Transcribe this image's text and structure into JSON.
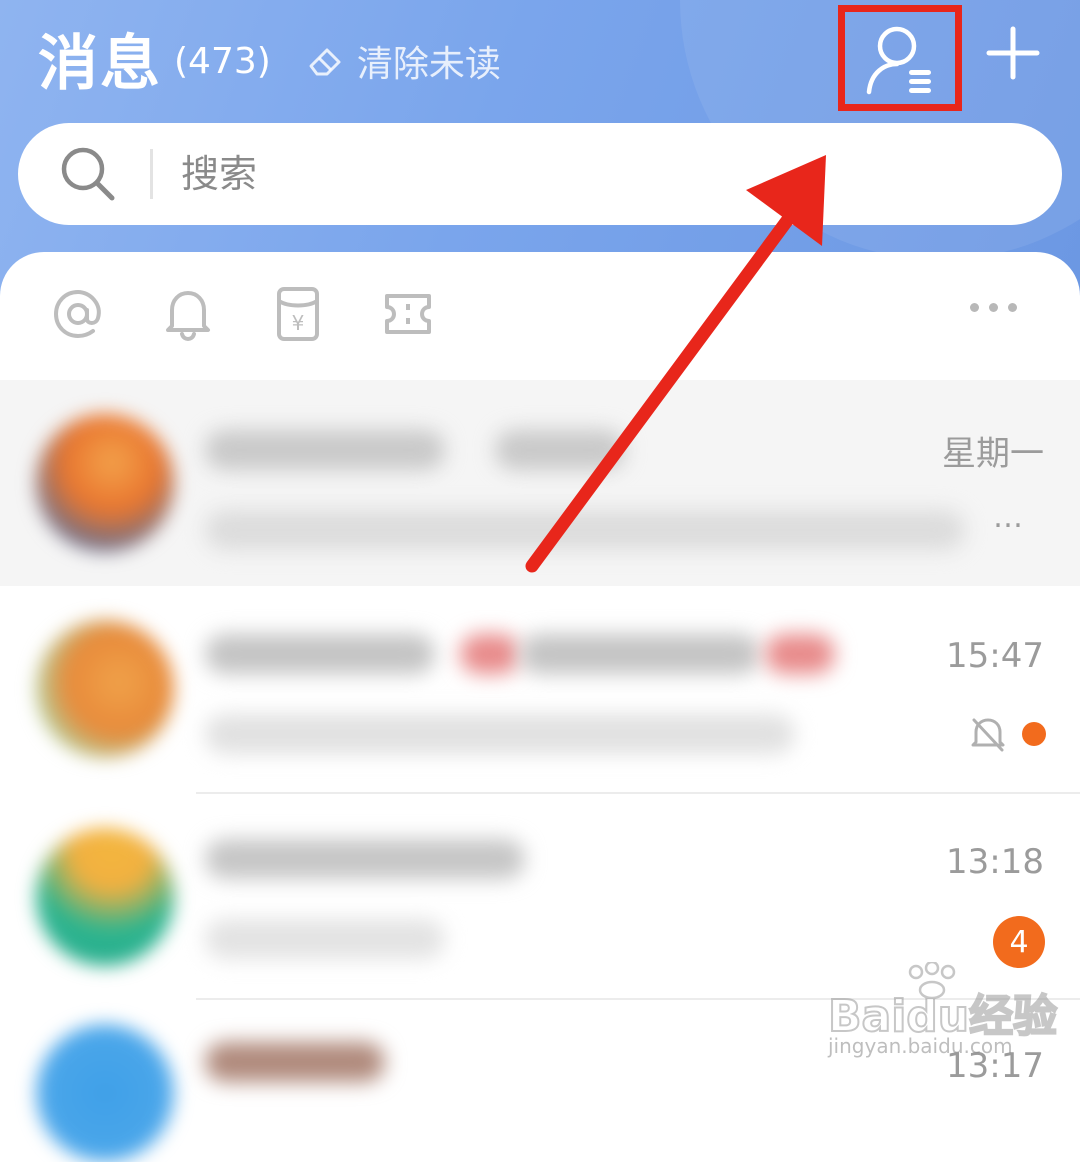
{
  "header": {
    "title": "消息",
    "count": "(473)",
    "clear_unread": "清除未读"
  },
  "search": {
    "placeholder": "搜索"
  },
  "quick_actions": [
    "mention-icon",
    "bell-icon",
    "red-envelope-icon",
    "ticket-icon",
    "more-dots-icon"
  ],
  "conversations": [
    {
      "time": "星期一",
      "extra": "…"
    },
    {
      "time": "15:47",
      "muted": true,
      "unread_dot": true
    },
    {
      "time": "13:18",
      "unread_count": "4"
    },
    {
      "time": "13:17"
    }
  ],
  "watermark": {
    "main": "Baidu经验",
    "sub": "jingyan.baidu.com"
  },
  "colors": {
    "header_blue": "#7aa5ec",
    "highlight_red": "#e8261b",
    "badge_orange": "#f26b1d"
  }
}
